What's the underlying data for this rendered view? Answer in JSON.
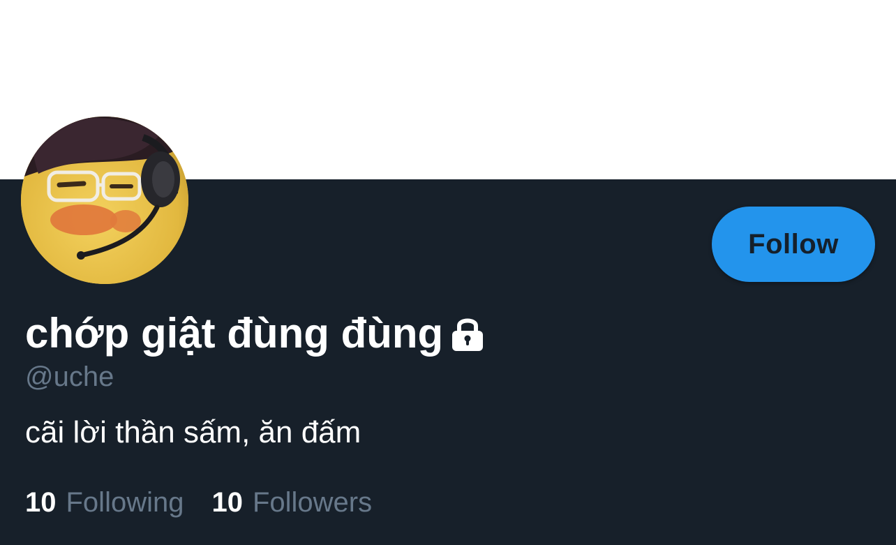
{
  "profile": {
    "display_name": "chớp giật đùng đùng",
    "handle": "@uche",
    "bio": "cãi lời thần sấm, ăn đấm",
    "protected_icon": "lock-icon",
    "avatar_icon": "avatar-duck-headset"
  },
  "actions": {
    "follow_label": "Follow"
  },
  "stats": {
    "following_count": "10",
    "following_label": "Following",
    "followers_count": "10",
    "followers_label": "Followers"
  },
  "colors": {
    "banner": "#ffffff",
    "background": "#17202a",
    "accent": "#2394ec",
    "secondary_text": "#67788a",
    "primary_text": "#ffffff"
  }
}
